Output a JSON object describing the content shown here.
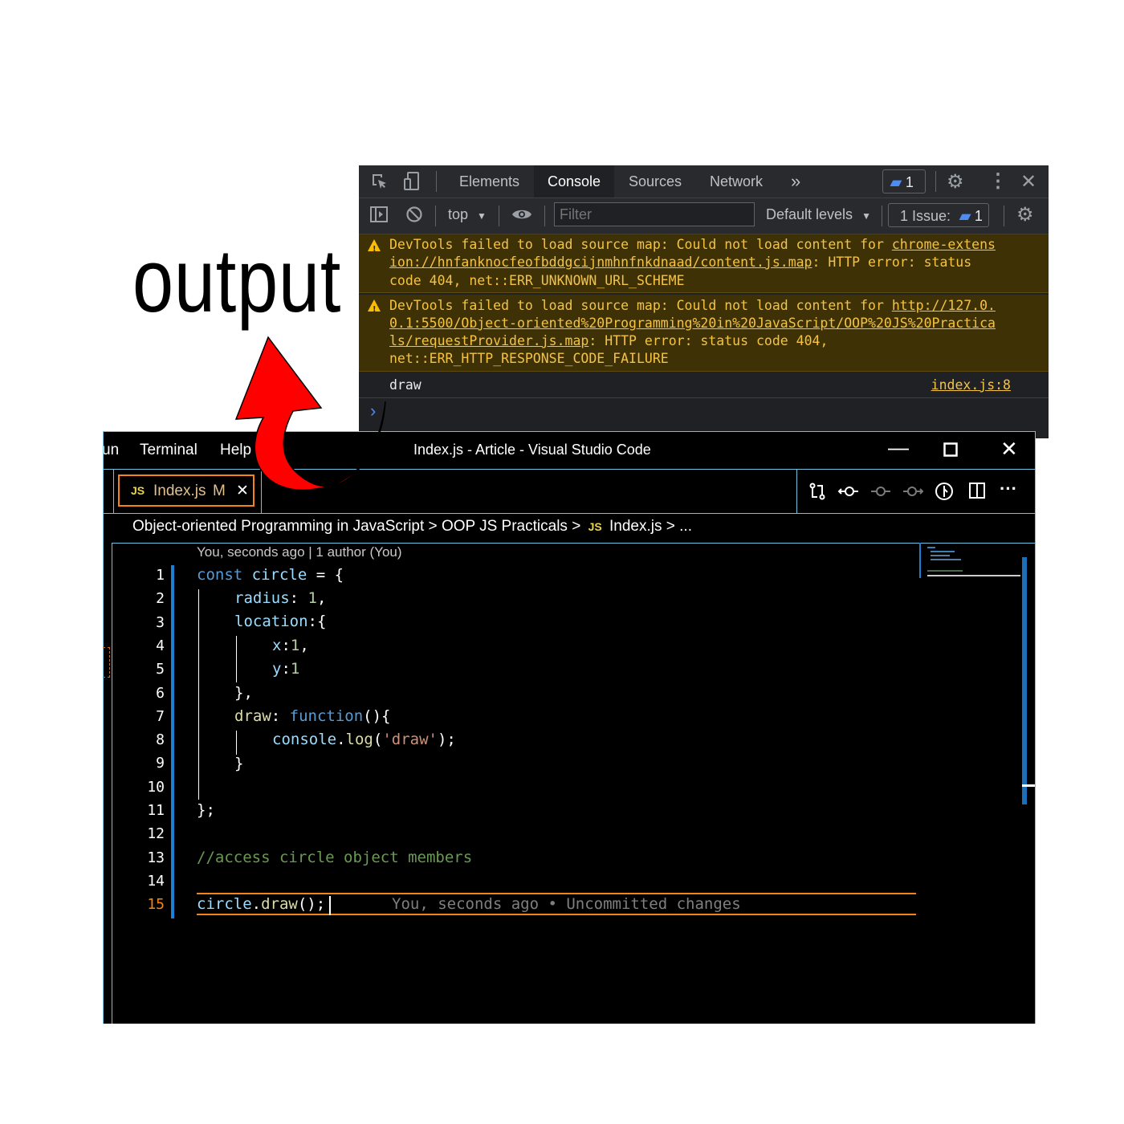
{
  "annotation": {
    "label": "output"
  },
  "devtools": {
    "tabs": [
      "Elements",
      "Console",
      "Sources",
      "Network"
    ],
    "more_tabs": "»",
    "issues_count_badge": "1",
    "context": "top",
    "filter_placeholder": "Filter",
    "levels": "Default levels",
    "issues_label": "1 Issue:",
    "issues_count": "1",
    "messages": [
      {
        "type": "warning",
        "lines": [
          [
            "DevTools failed to load source map: Could not load content for ",
            "chrome-extens"
          ],
          [
            "",
            "ion://hnfanknocfeofbddgcijnmhnfnkdnaad/content.js.map",
            ": HTTP error: status"
          ],
          [
            "code 404, net::ERR_UNKNOWN_URL_SCHEME"
          ]
        ]
      },
      {
        "type": "warning",
        "lines": [
          [
            "DevTools failed to load source map: Could not load content for ",
            "http://127.0."
          ],
          [
            "",
            "0.1:5500/Object-oriented%20Programming%20in%20JavaScript/OOP%20JS%20Practica"
          ],
          [
            "",
            "ls/requestProvider.js.map",
            ": HTTP error: status code 404,"
          ],
          [
            "net::ERR_HTTP_RESPONSE_CODE_FAILURE"
          ]
        ]
      },
      {
        "type": "log",
        "text": "draw",
        "source": "index.js:8"
      }
    ],
    "prompt": "›"
  },
  "vscode": {
    "menu": [
      "un",
      "Terminal",
      "Help"
    ],
    "title": "Index.js - Article - Visual Studio Code",
    "tab": {
      "badge": "JS",
      "name": "Index.js",
      "status": "M",
      "close": "✕"
    },
    "breadcrumb": [
      "Object-oriented Programming in JavaScript",
      "OOP JS Practicals",
      "Index.js",
      "..."
    ],
    "breadcrumb_sep": ">",
    "blame_header": "You, seconds ago | 1 author (You)",
    "line_numbers": [
      "1",
      "2",
      "3",
      "4",
      "5",
      "6",
      "7",
      "8",
      "9",
      "10",
      "11",
      "12",
      "13",
      "14",
      "15"
    ],
    "current_line": "15",
    "code": {
      "l1": [
        "const",
        " ",
        "circle",
        " = {"
      ],
      "l2": [
        "radius",
        ": ",
        "1",
        ","
      ],
      "l3": [
        "location",
        ":{"
      ],
      "l4": [
        "x",
        ":",
        "1",
        ","
      ],
      "l5": [
        "y",
        ":",
        "1"
      ],
      "l6": "},",
      "l7": [
        "draw",
        ": ",
        "function",
        "(){"
      ],
      "l8": [
        "console",
        ".",
        "log",
        "(",
        "'draw'",
        ");"
      ],
      "l9": "}",
      "l11": "};",
      "l13": "//access circle object members",
      "l15": [
        "circle",
        ".",
        "draw",
        "();"
      ],
      "inline_blame": "You, seconds ago • Uncommitted changes"
    }
  },
  "colors": {
    "accent_orange": "#f38518",
    "hc_border": "#6fc3df",
    "arrow_red": "#ff0000"
  }
}
